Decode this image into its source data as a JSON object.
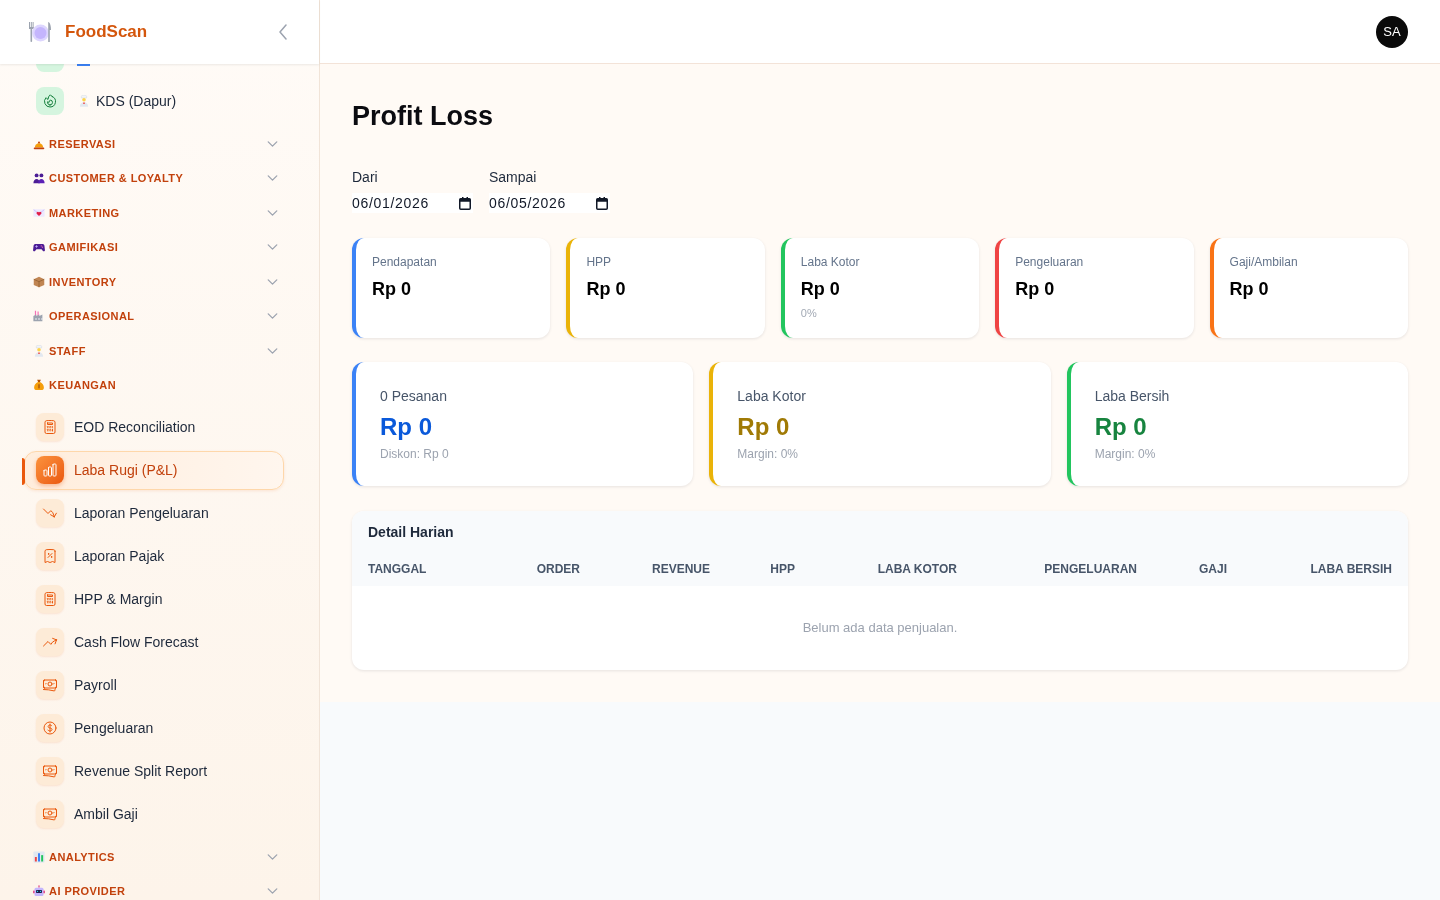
{
  "sidebar": {
    "brand": "FoodScan",
    "items": [
      {
        "label": "KDS (Dapur)",
        "selected": false
      }
    ],
    "sections": [
      {
        "title": "RESERVASI",
        "expanded": false
      },
      {
        "title": "CUSTOMER & LOYALTY",
        "expanded": false
      },
      {
        "title": "MARKETING",
        "expanded": false
      },
      {
        "title": "GAMIFIKASI",
        "expanded": false
      },
      {
        "title": "INVENTORY",
        "expanded": false
      },
      {
        "title": "OPERASIONAL",
        "expanded": false
      },
      {
        "title": "STAFF",
        "expanded": false
      },
      {
        "title": "KEUANGAN",
        "expanded": true,
        "children": [
          {
            "label": "EOD Reconciliation",
            "selected": false
          },
          {
            "label": "Laba Rugi (P&L)",
            "selected": true
          },
          {
            "label": "Laporan Pengeluaran",
            "selected": false
          },
          {
            "label": "Laporan Pajak",
            "selected": false
          },
          {
            "label": "HPP & Margin",
            "selected": false
          },
          {
            "label": "Cash Flow Forecast",
            "selected": false
          },
          {
            "label": "Payroll",
            "selected": false
          },
          {
            "label": "Pengeluaran",
            "selected": false
          },
          {
            "label": "Revenue Split Report",
            "selected": false
          },
          {
            "label": "Ambil Gaji",
            "selected": false
          }
        ]
      },
      {
        "title": "ANALYTICS",
        "expanded": false
      },
      {
        "title": "AI PROVIDER",
        "expanded": false
      }
    ]
  },
  "header": {
    "avatar": "SA"
  },
  "page": {
    "title": "Profit Loss",
    "filters": [
      {
        "label": "Dari",
        "value": "06/01/2026"
      },
      {
        "label": "Sampai",
        "value": "06/05/2026"
      }
    ]
  },
  "summary_cards": [
    {
      "label": "Pendapatan",
      "value": "Rp 0",
      "color": "#3b82f6"
    },
    {
      "label": "HPP",
      "value": "Rp 0",
      "color": "#eab308"
    },
    {
      "label": "Laba Kotor",
      "value": "Rp 0",
      "note": "0%",
      "color": "#22c55e"
    },
    {
      "label": "Pengeluaran",
      "value": "Rp 0",
      "color": "#ef4444"
    },
    {
      "label": "Gaji/Ambilan",
      "value": "Rp 0",
      "color": "#f97316"
    }
  ],
  "totals_cards": [
    {
      "label": "0 Pesanan",
      "value": "Rp 0",
      "note": "Diskon: Rp 0",
      "color": "#3b82f6"
    },
    {
      "label": "Laba Kotor",
      "value": "Rp 0",
      "note": "Margin: 0%",
      "color": "#eab308"
    },
    {
      "label": "Laba Bersih",
      "value": "Rp 0",
      "note": "Margin: 0%",
      "color": "#22c55e"
    }
  ],
  "table": {
    "title": "Detail Harian",
    "columns": [
      "TANGGAL",
      "ORDER",
      "REVENUE",
      "HPP",
      "LABA KOTOR",
      "PENGELUARAN",
      "GAJI",
      "LABA BERSIH"
    ],
    "empty_message": "Belum ada data penjualan."
  }
}
